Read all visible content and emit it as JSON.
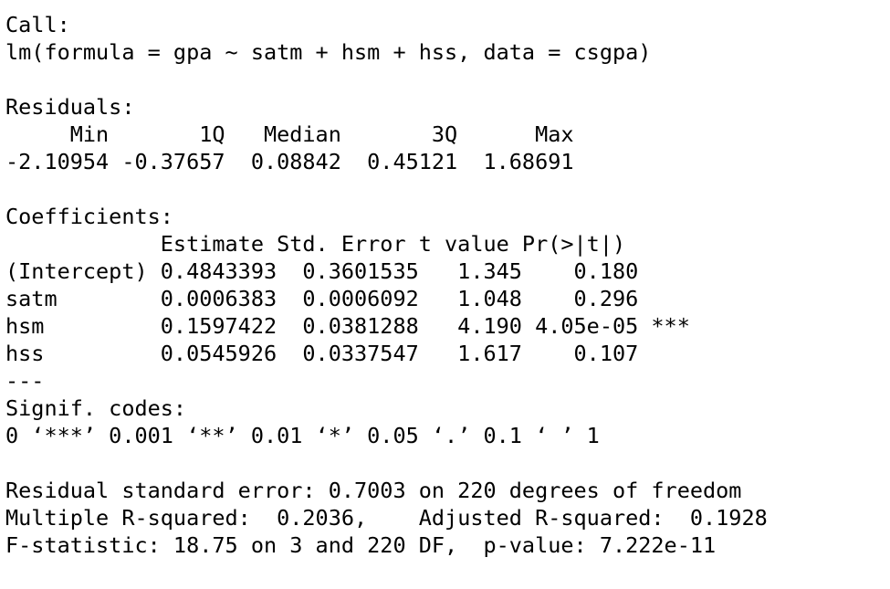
{
  "console": {
    "lines": [
      "Call:",
      "lm(formula = gpa ~ satm + hsm + hss, data = csgpa)",
      "",
      "Residuals:",
      "     Min       1Q   Median       3Q      Max ",
      "-2.10954 -0.37657  0.08842  0.45121  1.68691 ",
      "",
      "Coefficients:",
      "            Estimate Std. Error t value Pr(>|t|)    ",
      "(Intercept) 0.4843393  0.3601535   1.345    0.180    ",
      "satm        0.0006383  0.0006092   1.048    0.296    ",
      "hsm         0.1597422  0.0381288   4.190 4.05e-05 ***",
      "hss         0.0545926  0.0337547   1.617    0.107    ",
      "---",
      "Signif. codes:  ",
      "0 ‘***’ 0.001 ‘**’ 0.01 ‘*’ 0.05 ‘.’ 0.1 ‘ ’ 1",
      "",
      "Residual standard error: 0.7003 on 220 degrees of freedom",
      "Multiple R-squared:  0.2036,\tAdjusted R-squared:  0.1928 ",
      "F-statistic: 18.75 on 3 and 220 DF,  p-value: 7.222e-11"
    ]
  }
}
